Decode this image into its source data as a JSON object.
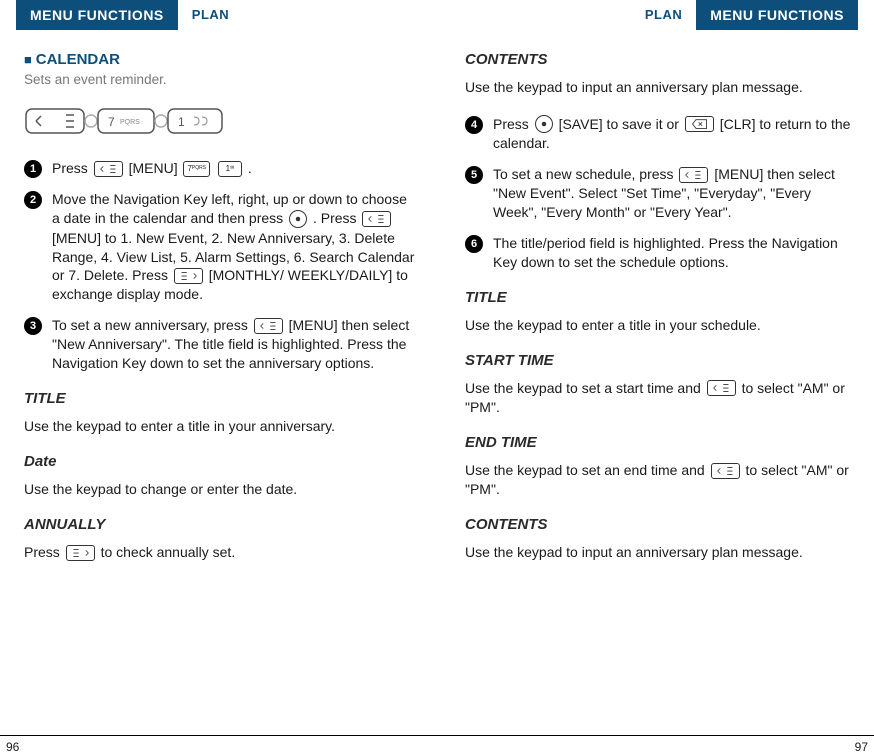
{
  "header": {
    "menu_functions": "MENU FUNCTIONS",
    "plan": "PLAN"
  },
  "left": {
    "section_marker": "■",
    "section_title": "CALENDAR",
    "section_sub": "Sets an event reminder.",
    "step1": "Press [MENU] .",
    "step1_a": "Press ",
    "step1_b": "[MENU] ",
    "step1_c": ".",
    "step2": "Move the Navigation Key left, right, up or down to choose a date in the calendar and then press   . Press [MENU] to 1. New Event, 2. New Anniversary, 3. Delete Range, 4. View List, 5. Alarm Settings, 6. Search Calendar or 7. Delete. Press [MONTHLY/ WEEKLY/DAILY] to exchange display mode.",
    "step2_a": "Move the Navigation Key left, right, up or down to choose a date in the calendar and then press ",
    "step2_b": " . Press ",
    "step2_c": "[MENU] to 1. New Event, 2. New Anniversary, 3. Delete Range, 4. View List, 5. Alarm Settings, 6. Search Calendar or 7. Delete. Press ",
    "step2_d": " [MONTHLY/ WEEKLY/DAILY] to exchange display mode.",
    "step3_a": "To set a new anniversary, press ",
    "step3_b": "[MENU] then select \"New Anniversary\". The title field is highlighted. Press the Navigation Key down to set the anniversary options.",
    "title_head": "TITLE",
    "title_body": "Use the keypad to enter a title in your anniversary.",
    "date_head": "Date",
    "date_body": "Use the keypad to change or enter the date.",
    "annually_head": "ANNUALLY",
    "annually_body_a": "Press ",
    "annually_body_b": " to check annually set."
  },
  "right": {
    "contents_head": "CONTENTS",
    "contents_body": "Use the keypad to input an anniversary plan message.",
    "step4_a": "Press  ",
    "step4_b": " [SAVE] to save it or",
    "step4_c": " [CLR] to return to the calendar.",
    "step5_a": "To set a new schedule, press ",
    "step5_b": " [MENU] then select \"New Event\". Select \"Set Time\", \"Everyday\", \"Every Week\", \"Every Month\" or \"Every Year\".",
    "step6": "The title/period field is highlighted. Press the Navigation Key down to set the schedule options.",
    "title2_head": "TITLE",
    "title2_body": "Use the keypad to enter a title in your schedule.",
    "start_head": "START TIME",
    "start_body_a": "Use the keypad to set a start time and ",
    "start_body_b": " to select \"AM\" or \"PM\".",
    "end_head": "END TIME",
    "end_body_a": "Use the keypad to set an end time and ",
    "end_body_b": " to select \"AM\" or \"PM\".",
    "contents2_head": "CONTENTS",
    "contents2_body": "Use the keypad to input an anniversary plan message."
  },
  "footer": {
    "left_page": "96",
    "right_page": "97"
  }
}
